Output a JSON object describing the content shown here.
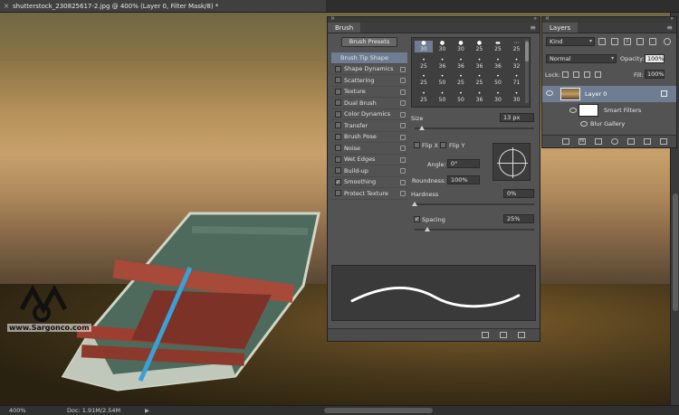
{
  "document": {
    "tab_title": "shutterstock_230825617-2.jpg @ 400% (Layer 0, Filter Mask/8) *",
    "watermark": "www.Sargonco.com"
  },
  "status": {
    "zoom": "400%",
    "doc_info": "Doc: 1.91M/2.54M",
    "arrow": "▶"
  },
  "brush": {
    "tab_label": "Brush",
    "presets_button": "Brush Presets",
    "options": [
      {
        "label": "Brush Tip Shape",
        "checkbox": false,
        "selected": true
      },
      {
        "label": "Shape Dynamics",
        "checkbox": true,
        "checked": false
      },
      {
        "label": "Scattering",
        "checkbox": true,
        "checked": false
      },
      {
        "label": "Texture",
        "checkbox": true,
        "checked": false
      },
      {
        "label": "Dual Brush",
        "checkbox": true,
        "checked": false
      },
      {
        "label": "Color Dynamics",
        "checkbox": true,
        "checked": false
      },
      {
        "label": "Transfer",
        "checkbox": true,
        "checked": false
      },
      {
        "label": "Brush Pose",
        "checkbox": true,
        "checked": false
      },
      {
        "label": "Noise",
        "checkbox": true,
        "checked": false
      },
      {
        "label": "Wet Edges",
        "checkbox": true,
        "checked": false
      },
      {
        "label": "Build-up",
        "checkbox": true,
        "checked": false
      },
      {
        "label": "Smoothing",
        "checkbox": true,
        "checked": true
      },
      {
        "label": "Protect Texture",
        "checkbox": true,
        "checked": false
      }
    ],
    "tip_sizes": [
      [
        "30",
        "30",
        "30",
        "25",
        "25",
        "25"
      ],
      [
        "25",
        "36",
        "36",
        "36",
        "36",
        "32"
      ],
      [
        "25",
        "50",
        "25",
        "25",
        "50",
        "71"
      ],
      [
        "25",
        "50",
        "50",
        "36",
        "30",
        "30"
      ]
    ],
    "size_label": "Size",
    "size_value": "13 px",
    "flip_x": "Flip X",
    "flip_y": "Flip Y",
    "angle_label": "Angle:",
    "angle_value": "0°",
    "roundness_label": "Roundness:",
    "roundness_value": "100%",
    "hardness_label": "Hardness",
    "hardness_value": "0%",
    "spacing_label": "Spacing",
    "spacing_value": "25%",
    "spacing_checked": true
  },
  "layers": {
    "tab_label": "Layers",
    "kind_label": "Kind",
    "blend_mode": "Normal",
    "opacity_label": "Opacity:",
    "opacity_value": "100%",
    "lock_label": "Lock:",
    "fill_label": "Fill:",
    "fill_value": "100%",
    "layer_name": "Layer 0",
    "smart_filters": "Smart Filters",
    "filter_name": "Blur Gallery"
  },
  "colors": {
    "panel": "#535353",
    "selected": "#6f7d93",
    "dark": "#3c3c3c"
  }
}
